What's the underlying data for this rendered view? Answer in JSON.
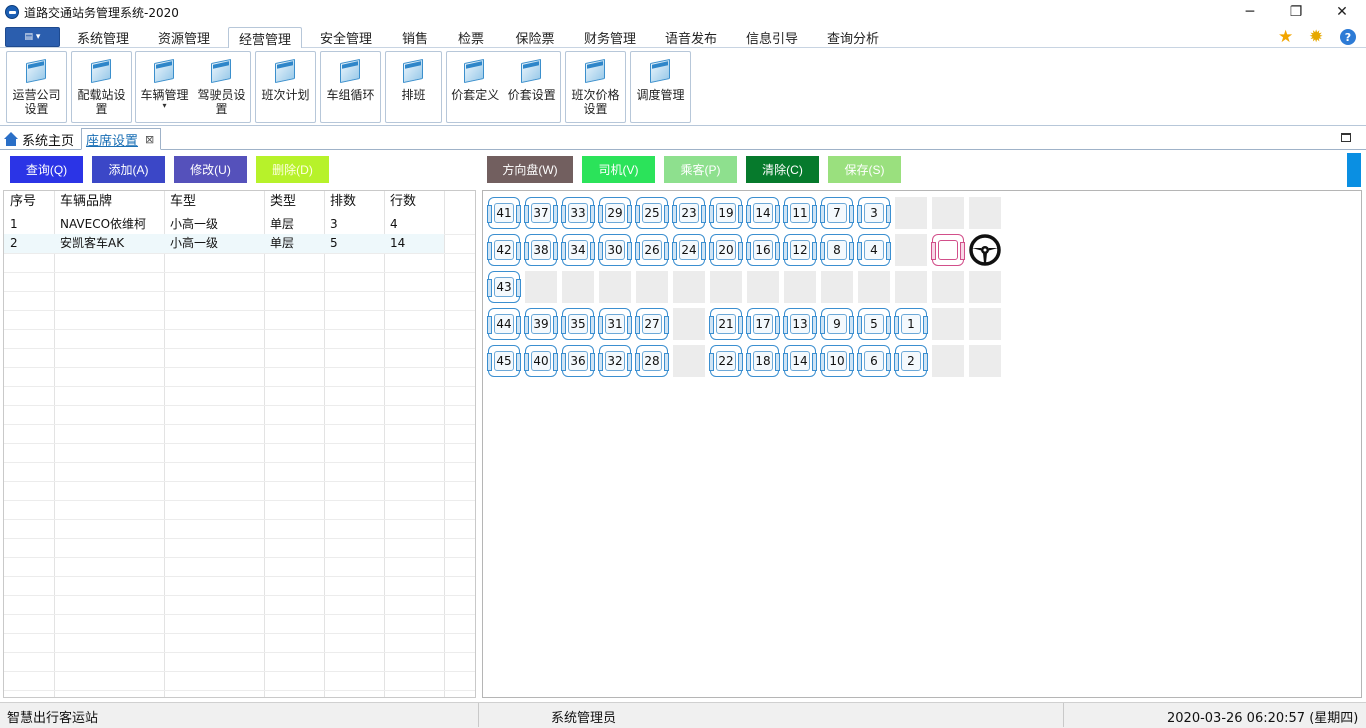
{
  "window": {
    "title": "道路交通站务管理系统-2020",
    "controls": {
      "minimize": "─",
      "restore": "❐",
      "close": "✕"
    }
  },
  "menu": {
    "app_button_icon": "▤ ▾",
    "tabs": [
      "系统管理",
      "资源管理",
      "经营管理",
      "安全管理",
      "销售",
      "检票",
      "保险票",
      "财务管理",
      "语音发布",
      "信息引导",
      "查询分析"
    ],
    "active_tab": "经营管理",
    "right_icons": [
      "star-icon",
      "gear-icon",
      "help-icon"
    ]
  },
  "ribbon": {
    "buttons": [
      "运营公司\n设置",
      "配载站设\n置",
      "车辆管理",
      "驾驶员设\n置",
      "班次计划",
      "车组循环",
      "排班",
      "价套定义",
      "价套设置",
      "班次价格\n设置",
      "调度管理"
    ]
  },
  "doc_tabs": {
    "home": "系统主页",
    "active": "座席设置"
  },
  "toolbar": {
    "query": "查询(Q)",
    "add": "添加(A)",
    "edit": "修改(U)",
    "delete": "删除(D)",
    "wheel": "方向盘(W)",
    "driver": "司机(V)",
    "passenger": "乘客(P)",
    "clear": "清除(C)",
    "save": "保存(S)",
    "colors": {
      "query": "#2b34e6",
      "add": "#3b47c7",
      "edit": "#5551bb",
      "delete": "#b7f22a",
      "wheel": "#725f5f",
      "driver": "#2be35a",
      "passenger": "#8ee08e",
      "clear": "#067a2c",
      "save": "#9ae07e"
    }
  },
  "table": {
    "columns": [
      "序号",
      "车辆品牌",
      "车型",
      "类型",
      "排数",
      "行数"
    ],
    "rows": [
      [
        "1",
        "NAVECO依维柯",
        "小高一级",
        "单层",
        "3",
        "4"
      ],
      [
        "2",
        "安凯客车AK",
        "小高一级",
        "单层",
        "5",
        "14"
      ]
    ]
  },
  "seat_layout": {
    "rows": [
      [
        "41",
        "37",
        "33",
        "29",
        "25",
        "23",
        "19",
        "14",
        "11",
        "7",
        "3",
        "",
        "",
        ""
      ],
      [
        "42",
        "38",
        "34",
        "30",
        "26",
        "24",
        "20",
        "16",
        "12",
        "8",
        "4",
        "",
        "D",
        "W"
      ],
      [
        "43",
        "",
        "",
        "",
        "",
        "",
        "",
        "",
        "",
        "",
        "",
        "",
        "",
        ""
      ],
      [
        "44",
        "39",
        "35",
        "31",
        "27",
        "",
        "21",
        "17",
        "13",
        "9",
        "5",
        "1",
        "",
        ""
      ],
      [
        "45",
        "40",
        "36",
        "32",
        "28",
        "",
        "22",
        "18",
        "14",
        "10",
        "6",
        "2",
        "",
        ""
      ]
    ],
    "legend": {
      "D": "driver-seat",
      "W": "steering-wheel"
    }
  },
  "status": {
    "station": "智慧出行客运站",
    "user": "系统管理员",
    "datetime": "2020-03-26 06:20:57 (星期四)"
  }
}
